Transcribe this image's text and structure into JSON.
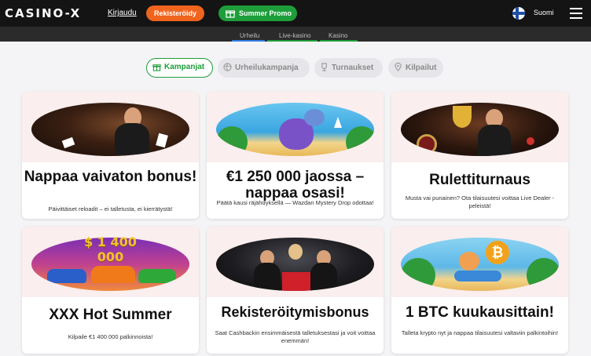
{
  "header": {
    "logo": "CASINO-X",
    "login": "Kirjaudu",
    "register": "Rekisteröidy",
    "promo": "Summer Promo",
    "language": "Suomi"
  },
  "subnav": {
    "tabs": [
      "Urheilu",
      "Live-kasino",
      "Kasino"
    ],
    "colors": [
      "#2f7de1",
      "#1e9e3a",
      "#1e9e3a"
    ]
  },
  "filters": [
    {
      "label": "Kampanjat",
      "active": true,
      "icon": "gift-icon"
    },
    {
      "label": "Urheilukampanja",
      "active": false,
      "icon": "ball-icon"
    },
    {
      "label": "Turnaukset",
      "active": false,
      "icon": "trophy-icon"
    },
    {
      "label": "Kilpailut",
      "active": false,
      "icon": "pin-icon"
    }
  ],
  "cards": [
    {
      "title": "Nappaa vaivaton bonus!",
      "desc": "Päivittäiset reloadit – ei talletusta, ei kierrätystä!",
      "art": "casino-dealer-art"
    },
    {
      "title": "€1 250 000 jaossa – nappaa osasi!",
      "desc": "Päätä kausi räjähdyksellä — Wazdan Mystery Drop odottaa!",
      "art": "dragon-beach-art"
    },
    {
      "title": "Rulettiturnaus",
      "desc": "Musta vai punainen? Ota tilaisuutesi voittaa Live Dealer -peleistä!",
      "art": "roulette-trophy-art"
    },
    {
      "title": "XXX Hot Summer",
      "desc": "Kilpaile €1 400 000 palkinnoista!",
      "art": "cars-prize-art",
      "prize": "$ 1 400 000"
    },
    {
      "title": "Rekisteröitymisbonus",
      "desc": "Saat Cashbackin ensimmäisestä talletuksestasi ja voit voittaa enemmän!",
      "art": "gift-dealers-art"
    },
    {
      "title": "1 BTC kuukausittain!",
      "desc": "Talleta krypto nyt ja nappaa tilaisuutesi valtaviin palkintoihin!",
      "art": "bitcoin-scooter-art"
    }
  ],
  "colors": {
    "accent_green": "#1e9e3a",
    "accent_orange": "#f1641e",
    "topbar": "#141414"
  }
}
